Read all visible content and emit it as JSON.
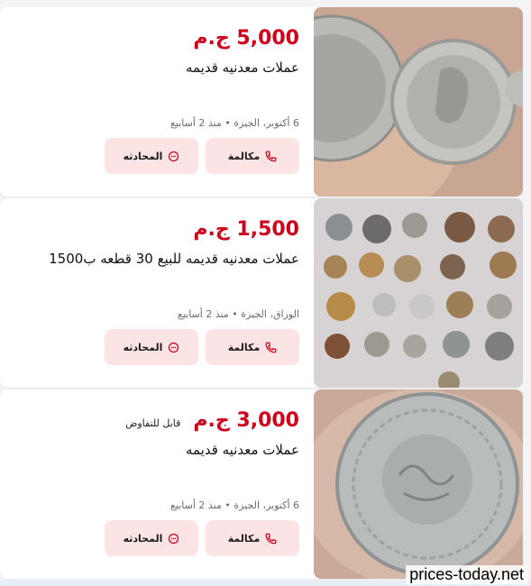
{
  "listings": [
    {
      "price": "5,000 ج.م",
      "negotiable": "",
      "title": "عملات معدنيه قديمه",
      "meta": "6 أكتوبر، الجيزة • منذ 2 أسابيع",
      "call_label": "مكالمة",
      "chat_label": "المحادثه",
      "image": "silver-coins-in-hand"
    },
    {
      "price": "1,500 ج.م",
      "negotiable": "",
      "title": "عملات معدنيه قديمه للبيع 30 قطعه ب1500",
      "meta": "الوراق، الجيزة • منذ 2 أسابيع",
      "call_label": "مكالمة",
      "chat_label": "المحادثه",
      "image": "coin-collection-grid"
    },
    {
      "price": "3,000 ج.م",
      "negotiable": "قابل للتفاوض",
      "title": "عملات معدنيه قديمه",
      "meta": "6 أكتوبر، الجيزة • منذ 2 أسابيع",
      "call_label": "مكالمة",
      "chat_label": "المحادثه",
      "image": "arabic-silver-coin"
    }
  ],
  "watermark": "prices-today.net",
  "colors": {
    "price": "#d0021b",
    "button_bg": "#fde4e4",
    "icon": "#d0021b"
  }
}
